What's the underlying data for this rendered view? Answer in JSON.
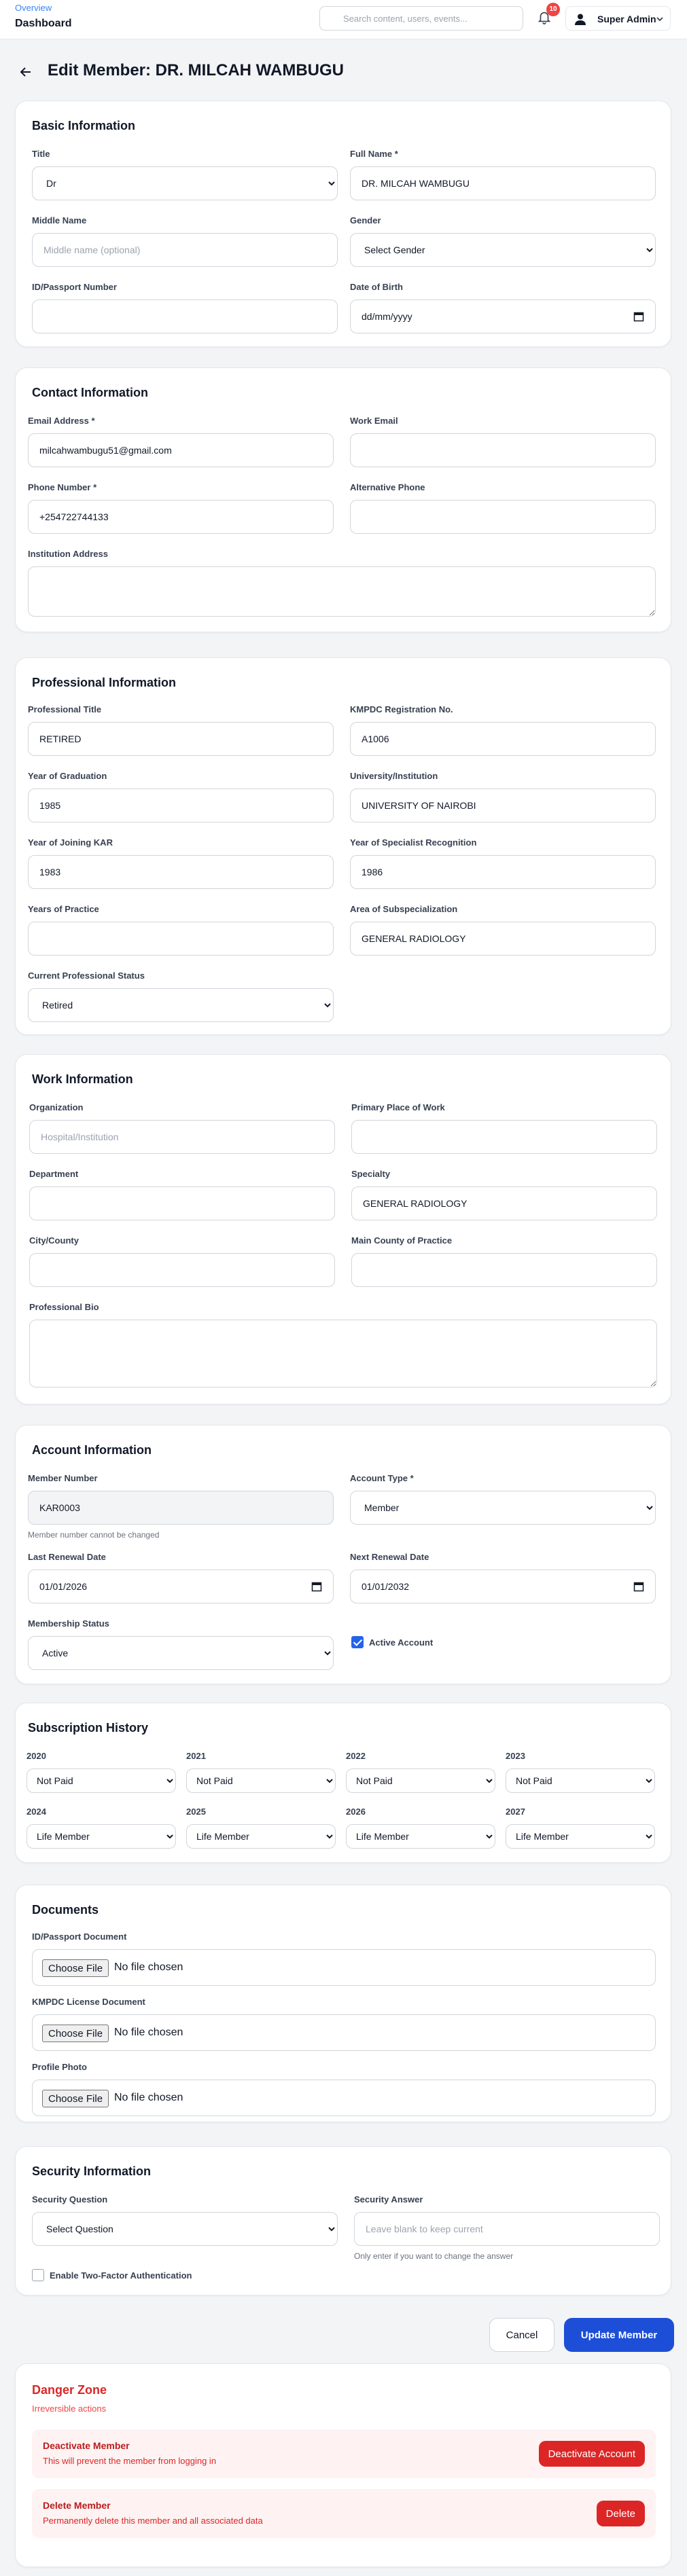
{
  "header": {
    "crumb_parent": "Overview",
    "crumb_current": "Dashboard",
    "search_placeholder": "Search content, users, events...",
    "notification_count": "10",
    "user_label": "Super Admin"
  },
  "page": {
    "title": "Edit Member: DR. MILCAH WAMBUGU"
  },
  "basic": {
    "title": "Basic Information",
    "title_label": "Title",
    "title_value": "Dr",
    "full_name_label": "Full Name *",
    "full_name_value": "DR. MILCAH WAMBUGU",
    "middle_name_label": "Middle Name",
    "middle_name_placeholder": "Middle name (optional)",
    "gender_label": "Gender",
    "gender_value": "Select Gender",
    "id_label": "ID/Passport Number",
    "dob_label": "Date of Birth",
    "dob_value": "dd/mm/yyyy"
  },
  "contact": {
    "title": "Contact Information",
    "email_label": "Email Address *",
    "email_value": "milcahwambugu51@gmail.com",
    "work_email_label": "Work Email",
    "phone_label": "Phone Number *",
    "phone_value": "+254722744133",
    "alt_phone_label": "Alternative Phone",
    "address_label": "Institution Address"
  },
  "professional": {
    "title": "Professional Information",
    "prof_title_label": "Professional Title",
    "prof_title_value": "RETIRED",
    "kmpdc_label": "KMPDC Registration No.",
    "kmpdc_value": "A1006",
    "grad_label": "Year of Graduation",
    "grad_value": "1985",
    "uni_label": "University/Institution",
    "uni_value": "UNIVERSITY OF NAIROBI",
    "kar_label": "Year of Joining KAR",
    "kar_value": "1983",
    "spec_year_label": "Year of Specialist Recognition",
    "spec_year_value": "1986",
    "practice_label": "Years of Practice",
    "subspec_label": "Area of Subspecialization",
    "subspec_value": "GENERAL RADIOLOGY",
    "status_label": "Current Professional Status",
    "status_value": "Retired"
  },
  "work": {
    "title": "Work Information",
    "org_label": "Organization",
    "org_placeholder": "Hospital/Institution",
    "primary_label": "Primary Place of Work",
    "dept_label": "Department",
    "specialty_label": "Specialty",
    "specialty_value": "GENERAL RADIOLOGY",
    "city_label": "City/County",
    "county_label": "Main County of Practice",
    "bio_label": "Professional Bio"
  },
  "account": {
    "title": "Account Information",
    "member_no_label": "Member Number",
    "member_no_value": "KAR0003",
    "member_no_hint": "Member number cannot be changed",
    "type_label": "Account Type *",
    "type_value": "Member",
    "last_renewal_label": "Last Renewal Date",
    "last_renewal_value": "01/01/2026",
    "next_renewal_label": "Next Renewal Date",
    "next_renewal_value": "01/01/2032",
    "status_label": "Membership Status",
    "status_value": "Active",
    "active_label": "Active Account"
  },
  "subscription": {
    "title": "Subscription History",
    "years": [
      {
        "year": "2020",
        "value": "Not Paid"
      },
      {
        "year": "2021",
        "value": "Not Paid"
      },
      {
        "year": "2022",
        "value": "Not Paid"
      },
      {
        "year": "2023",
        "value": "Not Paid"
      },
      {
        "year": "2024",
        "value": "Life Member"
      },
      {
        "year": "2025",
        "value": "Life Member"
      },
      {
        "year": "2026",
        "value": "Life Member"
      },
      {
        "year": "2027",
        "value": "Life Member"
      }
    ]
  },
  "documents": {
    "title": "Documents",
    "id_doc_label": "ID/Passport Document",
    "kmpdc_doc_label": "KMPDC License Document",
    "photo_label": "Profile Photo",
    "choose_label": "Choose File",
    "no_file": "No file chosen"
  },
  "security": {
    "title": "Security Information",
    "question_label": "Security Question",
    "question_value": "Select Question",
    "answer_label": "Security Answer",
    "answer_placeholder": "Leave blank to keep current",
    "answer_hint": "Only enter if you want to change the answer",
    "twofa_label": "Enable Two-Factor Authentication"
  },
  "actions": {
    "cancel": "Cancel",
    "update": "Update Member"
  },
  "danger": {
    "title": "Danger Zone",
    "subtitle": "Irreversible actions",
    "deactivate_title": "Deactivate Member",
    "deactivate_desc": "This will prevent the member from logging in",
    "deactivate_btn": "Deactivate Account",
    "delete_title": "Delete Member",
    "delete_desc": "Permanently delete this member and all associated data",
    "delete_btn": "Delete"
  },
  "colors": {
    "accent": "#1d4ed8",
    "danger": "#dc2626",
    "badge": "#ef4444"
  }
}
